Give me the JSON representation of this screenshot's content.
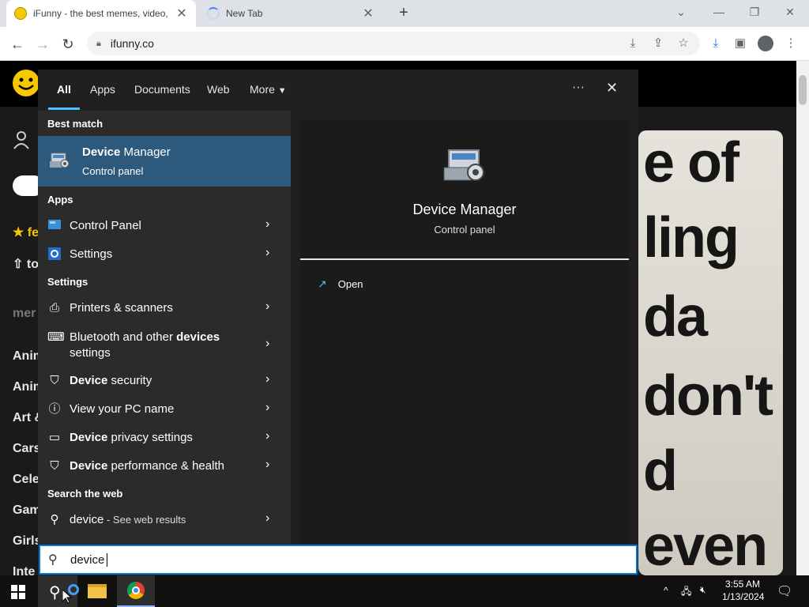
{
  "browser": {
    "tabs": [
      {
        "title": "iFunny - the best memes, video,"
      },
      {
        "title": "New Tab"
      }
    ],
    "url": "ifunny.co"
  },
  "page": {
    "nav_partial": [
      "fe",
      "to"
    ],
    "menu_heading": "mer",
    "categories": [
      "Anim",
      "Anim",
      "Art &",
      "Cars",
      "Cele",
      "Gam",
      "Girls",
      "Inte"
    ],
    "meme_lines": [
      "e of",
      "ling",
      "da",
      "don't",
      "d",
      "even"
    ]
  },
  "start_search": {
    "filters": {
      "all": "All",
      "apps": "Apps",
      "documents": "Documents",
      "web": "Web",
      "more": "More"
    },
    "sections": {
      "best_match": "Best match",
      "apps": "Apps",
      "settings": "Settings",
      "web": "Search the web"
    },
    "best_match": {
      "name_bold": "Device",
      "name_rest": " Manager",
      "subtitle": "Control panel"
    },
    "apps": [
      {
        "label": "Control Panel"
      },
      {
        "label": "Settings"
      }
    ],
    "settings": [
      {
        "label": "Printers & scanners"
      },
      {
        "label_pre": "Bluetooth and other ",
        "label_bold": "devices",
        "label_line2": "settings"
      },
      {
        "label_bold": "Device",
        "label_rest": " security"
      },
      {
        "label": "View your PC name"
      },
      {
        "label_bold": "Device",
        "label_rest": " privacy settings"
      },
      {
        "label_bold": "Device",
        "label_rest": " performance & health"
      }
    ],
    "web": {
      "query": "device",
      "suffix": " - See web results"
    },
    "detail": {
      "title": "Device Manager",
      "subtitle": "Control panel",
      "open": "Open"
    },
    "query": "device"
  },
  "taskbar": {
    "time": "3:55 AM",
    "date": "1/13/2024"
  },
  "colors": {
    "accent": "#0078d4",
    "selection": "#2d5a7c",
    "panel": "#202020"
  }
}
